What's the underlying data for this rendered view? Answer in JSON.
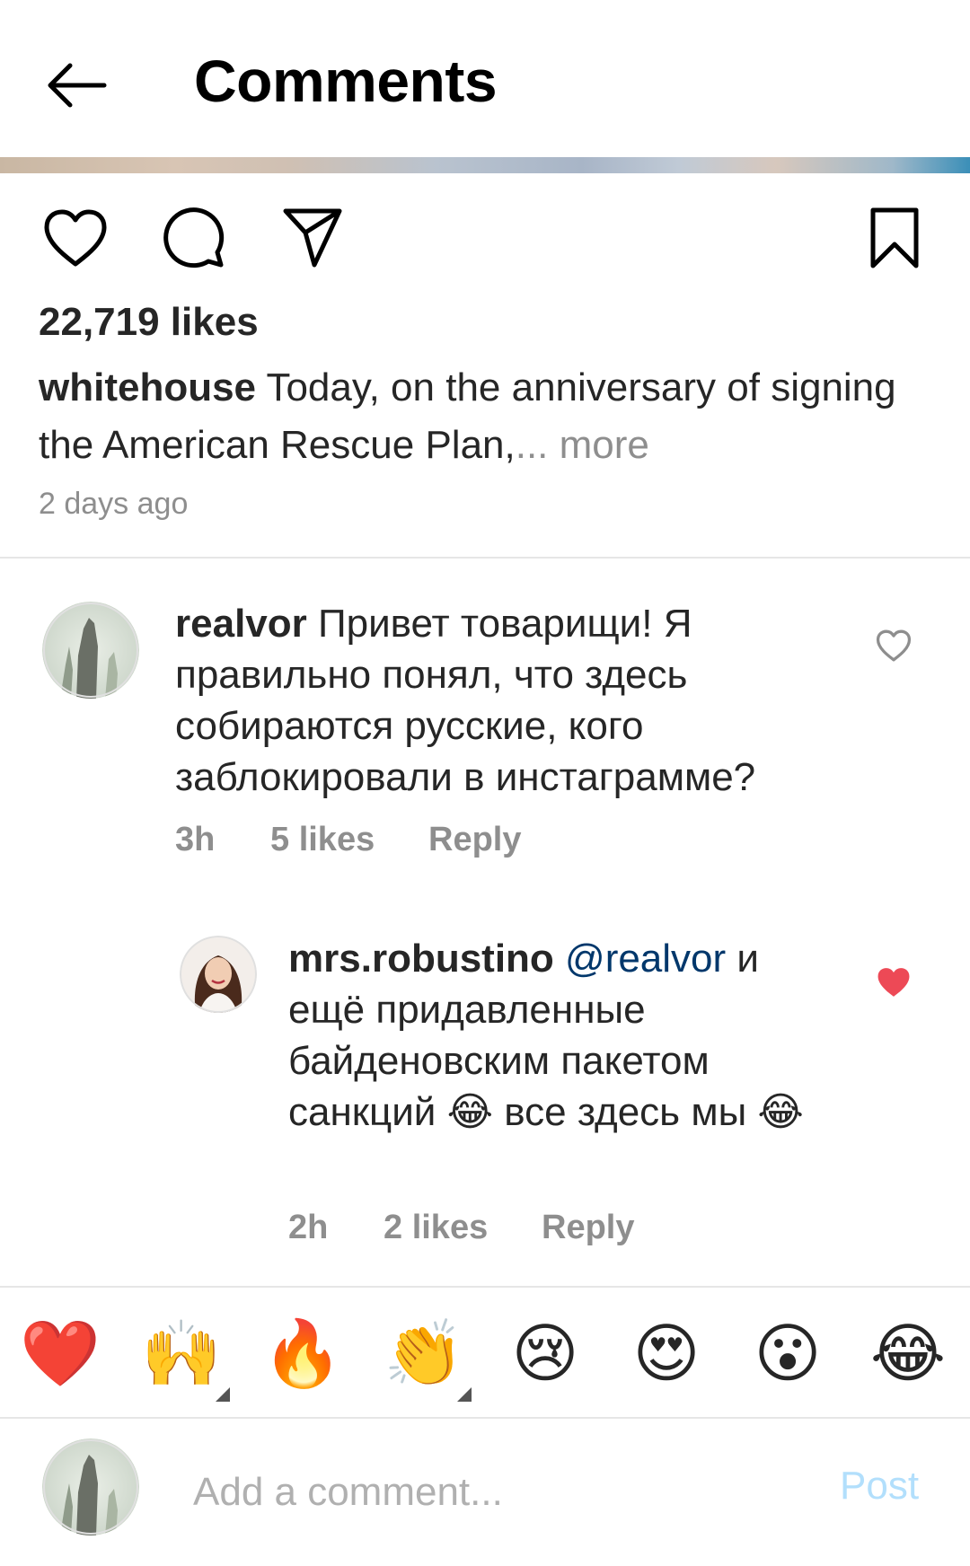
{
  "header": {
    "title": "Comments"
  },
  "post": {
    "likes": "22,719 likes",
    "caption_user": "whitehouse",
    "caption_text": " Today, on the anniversary of signing the American Rescue Plan,",
    "caption_more": "... more",
    "time_ago": "2 days ago"
  },
  "comments": [
    {
      "username": "realvor",
      "text": " Привет товарищи! Я правильно понял, что здесь собираются русские, кого заблокировали в инстаграмме?",
      "time": "3h",
      "likes": "5 likes",
      "reply": "Reply",
      "liked": false
    },
    {
      "username": "mrs.robustino",
      "mention": " @realvor",
      "text": " и ещё придавленные байденовским пакетом санкций 😂 все здесь мы 😂",
      "time": "2h",
      "likes": "2 likes",
      "reply": "Reply",
      "liked": true
    }
  ],
  "emoji_bar": [
    "❤️",
    "🙌",
    "🔥",
    "👏",
    "😢",
    "😍",
    "😮",
    "😂"
  ],
  "input": {
    "placeholder": "Add a comment...",
    "post_label": "Post"
  },
  "colors": {
    "liked_heart": "#ed4956",
    "post_disabled": "#b2dffc",
    "mention": "#00376b",
    "secondary_text": "#8e8e8e"
  }
}
